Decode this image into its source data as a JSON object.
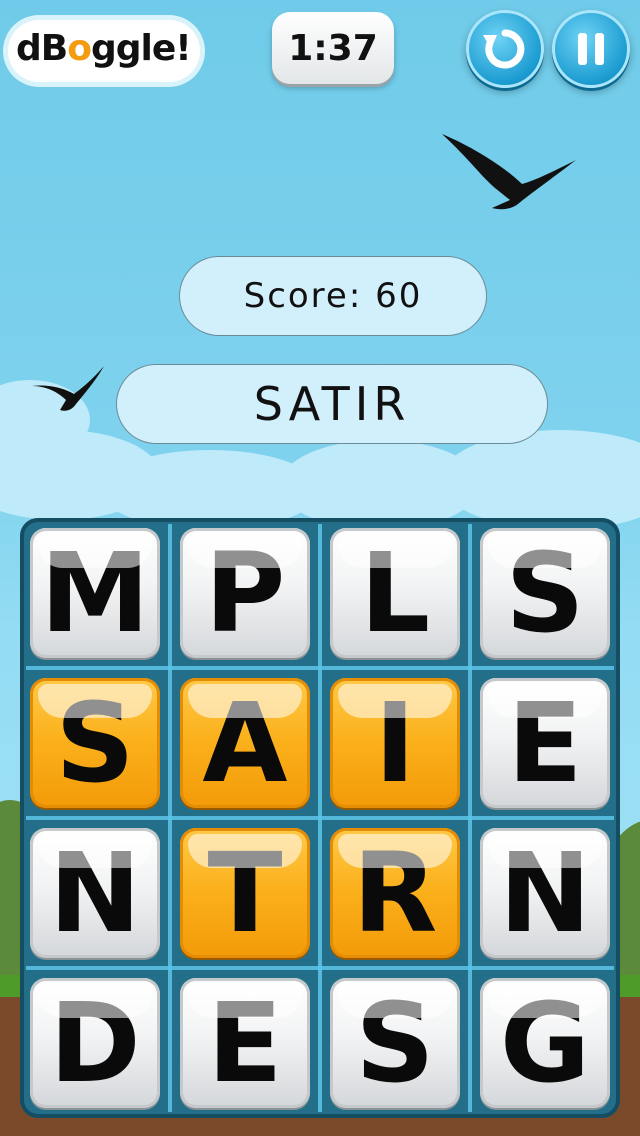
{
  "header": {
    "logo_text": "dBoggle!",
    "timer": "1:37",
    "restart_icon": "restart-icon",
    "pause_icon": "pause-icon"
  },
  "score": {
    "label": "Score: 60",
    "value": 60
  },
  "current_word": "SATIR",
  "board": {
    "rows": [
      [
        {
          "letter": "M",
          "selected": false
        },
        {
          "letter": "P",
          "selected": false
        },
        {
          "letter": "L",
          "selected": false
        },
        {
          "letter": "S",
          "selected": false
        }
      ],
      [
        {
          "letter": "S",
          "selected": true
        },
        {
          "letter": "A",
          "selected": true
        },
        {
          "letter": "I",
          "selected": true
        },
        {
          "letter": "E",
          "selected": false
        }
      ],
      [
        {
          "letter": "N",
          "selected": false
        },
        {
          "letter": "T",
          "selected": true
        },
        {
          "letter": "R",
          "selected": true
        },
        {
          "letter": "N",
          "selected": false
        }
      ],
      [
        {
          "letter": "D",
          "selected": false
        },
        {
          "letter": "E",
          "selected": false
        },
        {
          "letter": "S",
          "selected": false
        },
        {
          "letter": "G",
          "selected": false
        }
      ]
    ]
  },
  "colors": {
    "sky": "#7fd2ee",
    "board": "#236f8a",
    "tile_plain": "#f2f3f4",
    "tile_selected": "#fbb21d",
    "button": "#1c9cd1",
    "logo_accent": "#f39c12"
  }
}
